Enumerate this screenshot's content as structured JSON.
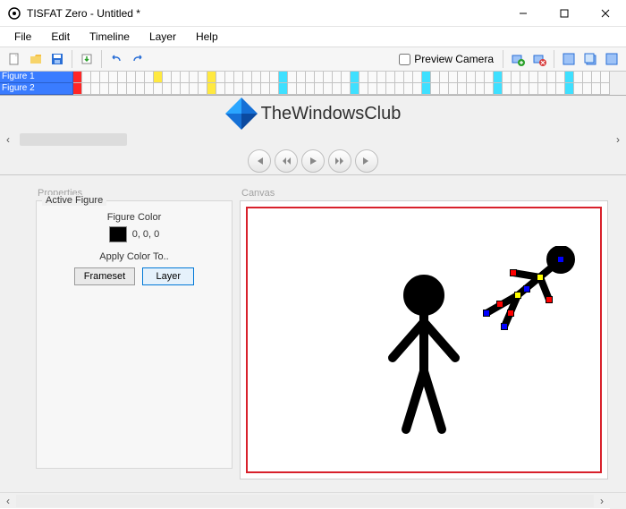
{
  "window": {
    "title": "TISFAT Zero - Untitled *"
  },
  "menus": [
    "File",
    "Edit",
    "Timeline",
    "Layer",
    "Help"
  ],
  "toolbar": {
    "preview_camera": "Preview Camera"
  },
  "timeline": {
    "figures": [
      "Figure 1",
      "Figure 2"
    ]
  },
  "watermark": {
    "text": "TheWindowsClub"
  },
  "panels": {
    "properties_title": "Properties",
    "properties_group": "Active Figure",
    "figure_color_label": "Figure Color",
    "figure_color_value": "0, 0, 0",
    "apply_color_label": "Apply Color To..",
    "frameset_btn": "Frameset",
    "layer_btn": "Layer",
    "canvas_title": "Canvas"
  }
}
